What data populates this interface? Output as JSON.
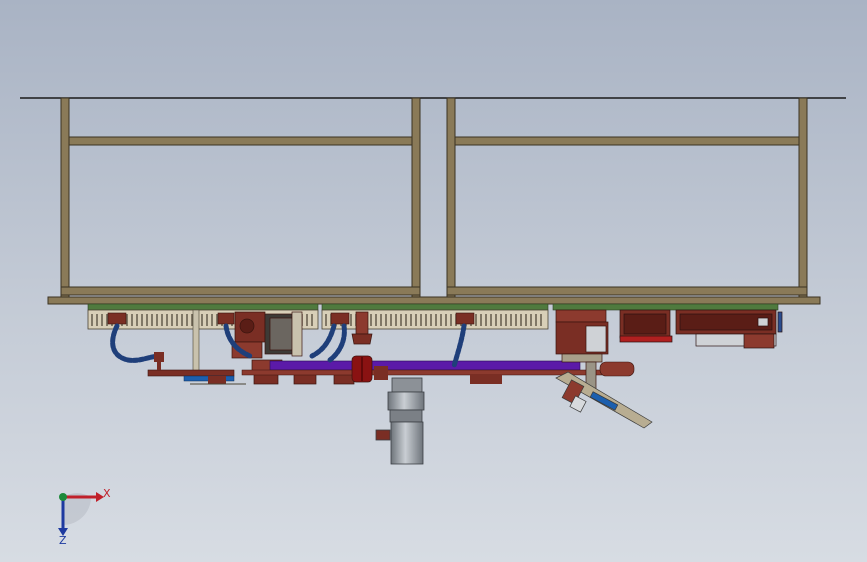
{
  "viewport": {
    "background_top": "#a9b3c4",
    "background_bottom": "#d7dce3"
  },
  "triad": {
    "x_label": "X",
    "z_label": "Z",
    "x_color": "#c0202a",
    "z_color": "#1e3aa0",
    "origin_color": "#1d8a3a"
  },
  "colors": {
    "frame_tan": "#8a7a58",
    "frame_edge": "#3b3322",
    "pcb_green": "#4f7a3e",
    "conveyor_cream": "#d8cfb8",
    "motor_maroon": "#7a2e24",
    "hose_blue": "#1f3f7a",
    "rail_purple": "#5b1aa8",
    "cylinder_gray": "#9aa0a6",
    "chassis_red": "#b02020"
  }
}
